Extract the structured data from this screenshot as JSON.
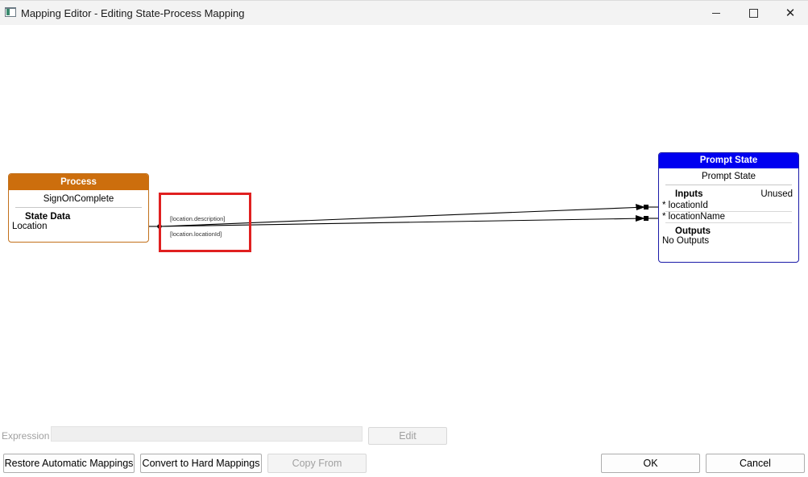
{
  "window": {
    "title": "Mapping Editor - Editing State-Process Mapping",
    "minimize_label": "",
    "close_glyph": "✕"
  },
  "process_node": {
    "header": "Process",
    "name": "SignOnComplete",
    "section": "State Data",
    "rows": [
      "Location"
    ],
    "header_color": "#cc6e0d"
  },
  "mapping": {
    "labels": [
      "[location.description]",
      "[location.locationId]"
    ],
    "highlight_color": "#e02020"
  },
  "prompt_node": {
    "header": "Prompt State",
    "name": "Prompt State",
    "inputs_title": "Inputs",
    "unused_label": "Unused",
    "inputs": [
      "* locationId",
      "* locationName"
    ],
    "outputs_title": "Outputs",
    "outputs_value": "No Outputs",
    "header_color": "#0000f0"
  },
  "expression": {
    "label": "Expression",
    "value": "",
    "edit_label": "Edit"
  },
  "buttons": {
    "restore": "Restore Automatic Mappings",
    "convert": "Convert to Hard Mappings",
    "copy_from": "Copy From",
    "ok": "OK",
    "cancel": "Cancel"
  }
}
